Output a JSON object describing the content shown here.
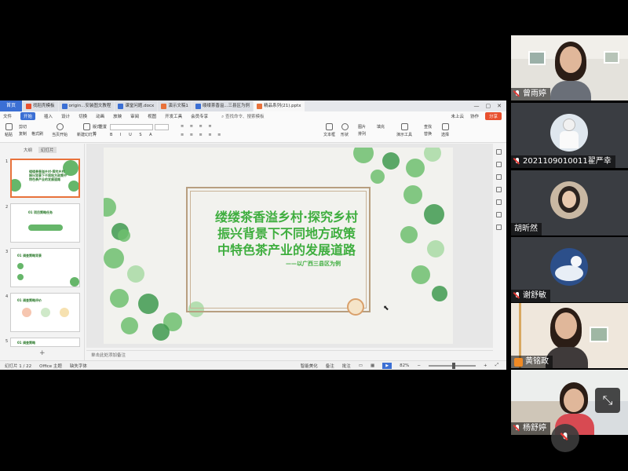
{
  "window_tabs": {
    "home": "首页",
    "tabs": [
      {
        "label": "找稻壳模板",
        "color": "#e8502e",
        "active": false
      },
      {
        "label": "origin...安装图文教程",
        "color": "#3b6fd4",
        "active": false
      },
      {
        "label": "课堂问题.docx",
        "color": "#3b6fd4",
        "active": false
      },
      {
        "label": "演示文稿1",
        "color": "#e8723b",
        "active": false
      },
      {
        "label": "缕缕茶香溢...三县区为例",
        "color": "#3b6fd4",
        "active": false
      },
      {
        "label": "精品系列(21).pptx",
        "color": "#e8723b",
        "active": true
      }
    ]
  },
  "menu": {
    "file": "文件",
    "items": [
      "开始",
      "插入",
      "设计",
      "切换",
      "动画",
      "放映",
      "审阅",
      "视图",
      "开发工具",
      "会员专享"
    ],
    "active_index": 0,
    "search": "查找命令、搜索模板",
    "cloud": "未上云",
    "collab": "协作",
    "share": "分享"
  },
  "toolbar": {
    "format_painter": "格式刷",
    "paste": "粘贴",
    "cut": "剪切",
    "copy": "复制",
    "play_from": "当页开始",
    "new_slide": "新建幻灯片",
    "layout": "版式",
    "section": "节",
    "reset": "重置",
    "font_name": "",
    "textbox": "文本框",
    "shape": "形状",
    "arrange": "排列",
    "picture": "图片",
    "fill": "填充",
    "slideshow_tools": "演示工具",
    "find": "查找",
    "replace": "替换",
    "select": "选择"
  },
  "sidebar": {
    "tabs": [
      "大纲",
      "幻灯片"
    ],
    "active_tab": 1,
    "slides": [
      {
        "num": "1",
        "text": "缕缕茶香溢乡村·探究乡村振兴背景下不同地方政策中特色茶产业的发展道路"
      },
      {
        "num": "2",
        "text": "01 项目策略任务"
      },
      {
        "num": "3",
        "text": "01 调查策略背景"
      },
      {
        "num": "4",
        "text": "01 调查策略评价"
      },
      {
        "num": "5",
        "text": "01 调查策略"
      }
    ]
  },
  "slide": {
    "title_lines": [
      "缕缕茶香溢乡村·探究乡村",
      "振兴背景下不同地方政策",
      "中特色茶产业的发展道路"
    ],
    "subtitle": "——以广西三县区为例"
  },
  "notes_placeholder": "单击此处添加备注",
  "status": {
    "slide_counter": "幻灯片 1 / 22",
    "theme": "Office 主题",
    "font_missing": "缺失字体",
    "smart_beautify": "智能美化",
    "notes": "备注",
    "comments": "批注",
    "zoom": "82%"
  },
  "participants": [
    {
      "name": "曾雨婷",
      "muted": true,
      "host": false
    },
    {
      "name": "2021109010011翟严幸",
      "muted": true,
      "host": false
    },
    {
      "name": "胡昕然",
      "muted": false,
      "host": false
    },
    {
      "name": "谢舒敏",
      "muted": true,
      "host": false
    },
    {
      "name": "黄铭政",
      "muted": false,
      "host": true
    },
    {
      "name": "杨舒婷",
      "muted": true,
      "host": false
    }
  ],
  "colors": {
    "accent_blue": "#3b6fd4",
    "title_green": "#3fae3f",
    "share_orange": "#e8502e",
    "host_orange": "#f08a24",
    "muted_red": "#e53935"
  }
}
